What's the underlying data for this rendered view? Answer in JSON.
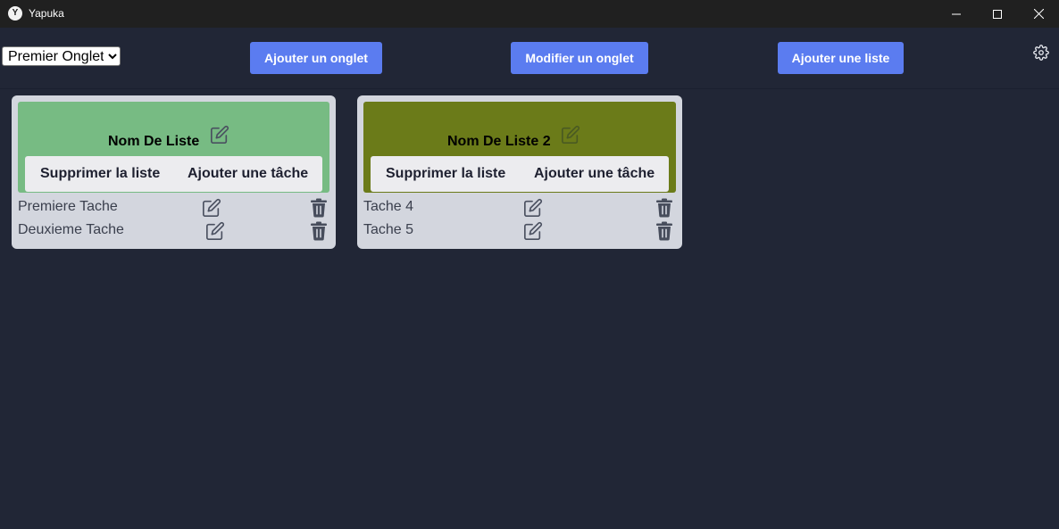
{
  "window": {
    "title": "Yapuka",
    "icon_letter": "Y"
  },
  "toolbar": {
    "tab_select": {
      "selected": "Premier Onglet",
      "options": [
        "Premier Onglet"
      ]
    },
    "add_tab_label": "Ajouter un onglet",
    "edit_tab_label": "Modifier un onglet",
    "add_list_label": "Ajouter une liste",
    "settings_icon": "gear-icon"
  },
  "lists": [
    {
      "name": "Nom De Liste",
      "header_color": "#77bb83",
      "delete_label": "Supprimer la liste",
      "add_task_label": "Ajouter une tâche",
      "tasks": [
        {
          "label": "Premiere Tache"
        },
        {
          "label": "Deuxieme Tache"
        }
      ]
    },
    {
      "name": "Nom De Liste 2",
      "header_color": "#6b7b19",
      "delete_label": "Supprimer la liste",
      "add_task_label": "Ajouter une tâche",
      "tasks": [
        {
          "label": "Tache 4"
        },
        {
          "label": "Tache 5"
        }
      ]
    }
  ],
  "colors": {
    "background": "#212636",
    "accent": "#5b7cf0",
    "card": "#d3d6de"
  }
}
